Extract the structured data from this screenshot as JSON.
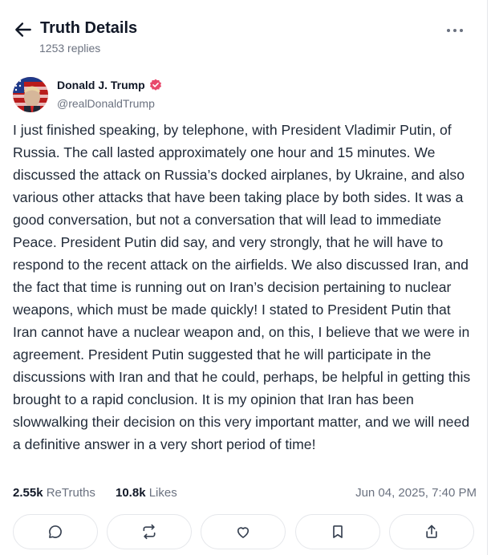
{
  "header": {
    "title": "Truth Details",
    "replies": "1253 replies",
    "back_icon": "arrow-left-icon",
    "more_icon": "more-horizontal-icon"
  },
  "post": {
    "author_name": "Donald J. Trump",
    "handle": "@realDonaldTrump",
    "verified_color": "#e8486b",
    "text": "I just finished speaking, by telephone, with President Vladimir Putin, of Russia. The call lasted approximately one hour and 15 minutes. We discussed the attack on Russia’s docked airplanes, by Ukraine, and also various other attacks that have been taking place by both sides. It was a good conversation, but not a conversation that will lead to immediate Peace. President Putin did say, and very strongly, that he will have to respond to the recent attack on the airfields. We also discussed Iran, and the fact that time is running out on Iran’s decision pertaining to nuclear weapons, which must be made quickly! I stated to President Putin that Iran cannot have a nuclear weapon and, on this, I believe that we were in agreement. President Putin suggested that he will participate in the discussions with Iran and that he could, perhaps, be helpful in getting this brought to a rapid conclusion. It is my opinion that Iran has been slowwalking their decision on this very important matter, and we will need a definitive answer in a very short period of time!"
  },
  "stats": {
    "retruths_count": "2.55k",
    "retruths_label": "ReTruths",
    "likes_count": "10.8k",
    "likes_label": "Likes",
    "date": "Jun 04, 2025, 7:40 PM"
  },
  "actions": {
    "icons": [
      "reply-icon",
      "retruth-icon",
      "like-icon",
      "bookmark-icon",
      "share-icon"
    ]
  }
}
